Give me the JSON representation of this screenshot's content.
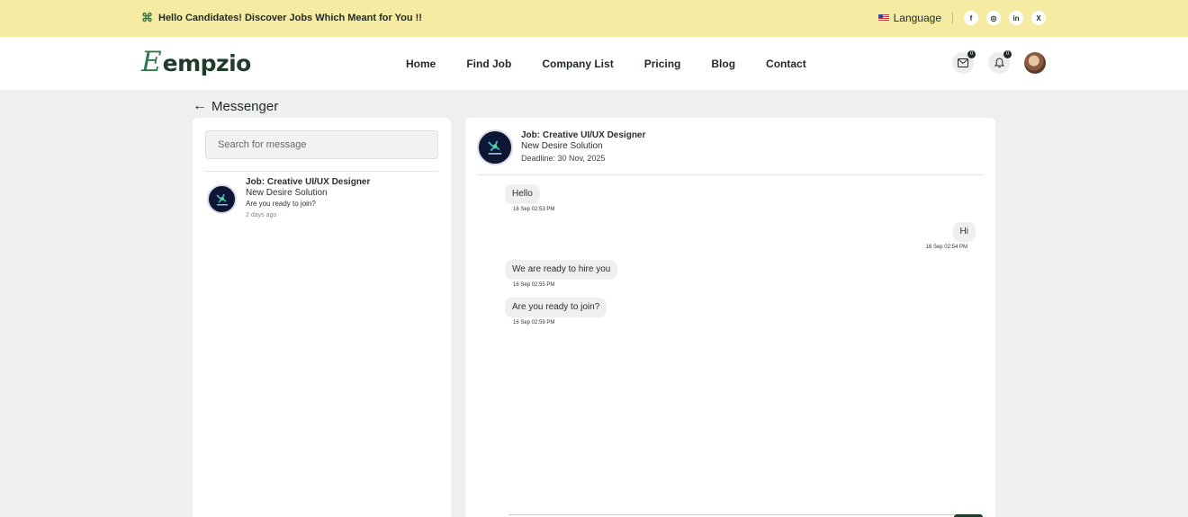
{
  "topbar": {
    "announcement": "Hello Candidates! Discover Jobs Which Meant for You !!",
    "language_label": "Language",
    "social": [
      {
        "icon": "facebook-icon",
        "glyph": "f"
      },
      {
        "icon": "instagram-icon",
        "glyph": "◎"
      },
      {
        "icon": "linkedin-icon",
        "glyph": "in"
      },
      {
        "icon": "x-twitter-icon",
        "glyph": "X"
      }
    ]
  },
  "header": {
    "logo_mark": "E",
    "logo_word": "empzio",
    "nav": [
      "Home",
      "Find Job",
      "Company List",
      "Pricing",
      "Blog",
      "Contact"
    ],
    "mail_badge": "0",
    "notification_badge": "0"
  },
  "messenger": {
    "title": "Messenger",
    "search_placeholder": "Search for message",
    "conversations": [
      {
        "job_title": "Job: Creative UI/UX Designer",
        "company": "New Desire Solution",
        "last_message": "Are you ready to join?",
        "time": "2 days ago"
      }
    ],
    "active_chat": {
      "job_title": "Job: Creative UI/UX Designer",
      "company": "New Desire Solution",
      "deadline": "Deadline: 30 Nov, 2025",
      "messages": [
        {
          "text": "Hello",
          "time": "16 Sep 02:53 PM",
          "direction": "in"
        },
        {
          "text": "Hi",
          "time": "16 Sep 02:54 PM",
          "direction": "out"
        },
        {
          "text": "We are ready to hire you",
          "time": "16 Sep 02:55 PM",
          "direction": "in"
        },
        {
          "text": "Are you ready to join?",
          "time": "16 Sep 02:59 PM",
          "direction": "in"
        }
      ]
    }
  },
  "colors": {
    "topbar_bg": "#f5eba3",
    "brand_green": "#2f7a4a",
    "brand_dark": "#1f3b2c",
    "page_bg": "#efefef"
  }
}
